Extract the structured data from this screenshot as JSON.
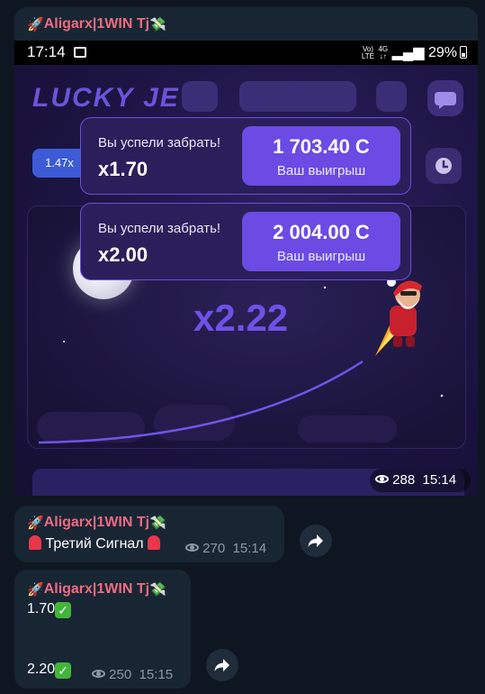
{
  "channel": {
    "sender_name": "Aligarx|1WIN Tj"
  },
  "screenshot": {
    "status": {
      "time": "17:14",
      "network_top": "Vo)",
      "network_bottom": "LTE",
      "data_top": "4G",
      "data_bottom": "↓↑",
      "battery": "29%"
    },
    "game": {
      "logo": "LUCKY JET",
      "multiplier_chip": "1.47x",
      "current_multiplier": "x2.22",
      "cashouts": [
        {
          "label": "Вы успели забрать!",
          "multiplier": "x1.70",
          "amount": "1 703.40 С",
          "amount_label": "Ваш выигрыш"
        },
        {
          "label": "Вы успели забрать!",
          "multiplier": "x2.00",
          "amount": "2 004.00 С",
          "amount_label": "Ваш выигрыш"
        }
      ]
    }
  },
  "messages": [
    {
      "views": "288",
      "time": "15:14"
    },
    {
      "text": "Третий Сигнал",
      "views": "270",
      "time": "15:14"
    },
    {
      "line1": "1.70",
      "line2": "2.20",
      "views": "250",
      "time": "15:15"
    }
  ],
  "colors": {
    "sender": "#e2586e",
    "bubble": "#182533",
    "background": "#0e1621",
    "accent_purple": "#6b4be3",
    "meta": "#8c9aa9"
  },
  "icons": [
    "rocket-icon",
    "money-icon",
    "eye-icon",
    "siren-icon",
    "check-icon",
    "forward-icon",
    "gallery-icon",
    "battery-icon",
    "clock-icon",
    "chat-icon"
  ]
}
